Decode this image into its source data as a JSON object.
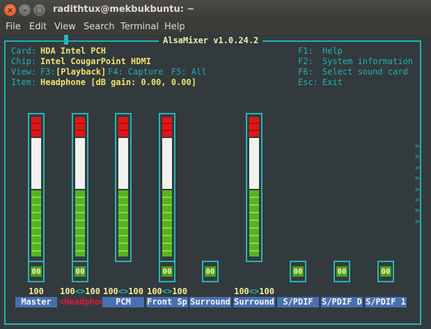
{
  "window": {
    "title": "radithtux@mekbukbuntu: ~",
    "close_glyph": "×",
    "min_glyph": "–",
    "max_glyph": "□"
  },
  "menu": [
    "File",
    "Edit",
    "View",
    "Search",
    "Terminal",
    "Help"
  ],
  "alsamixer": {
    "title": "AlsaMixer v1.0.24.2",
    "card": {
      "label": "Card:",
      "value": "HDA Intel PCH"
    },
    "chip": {
      "label": "Chip:",
      "value": "Intel CougarPoint HDMI"
    },
    "view": {
      "label": "View:",
      "f3": "F3:",
      "playback": "[Playback]",
      "f4": "F4: Capture",
      "f5": "F5: All"
    },
    "item": {
      "label": "Item:",
      "value": "Headphone [dB gain: 0.00, 0.00]"
    },
    "keys": [
      {
        "key": "F1:",
        "action": "Help"
      },
      {
        "key": "F2:",
        "action": "System information"
      },
      {
        "key": "F6:",
        "action": "Select sound card"
      },
      {
        "key": "Esc:",
        "action": "Exit"
      }
    ],
    "channels": [
      {
        "label": "Master",
        "volume": "100",
        "mute": "00",
        "has_bar": true,
        "level": 1.0,
        "selected": false
      },
      {
        "label": "<Headphon>",
        "volume": "100<>100",
        "mute": "00",
        "has_bar": true,
        "level": 1.0,
        "selected": true
      },
      {
        "label": "PCM",
        "volume": "100<>100",
        "mute": "",
        "has_bar": true,
        "level": 1.0,
        "selected": false
      },
      {
        "label": "Front Sp",
        "volume": "100<>100",
        "mute": "00",
        "has_bar": true,
        "level": 1.0,
        "selected": false
      },
      {
        "label": "Surround",
        "volume": "",
        "mute": "00",
        "has_bar": false,
        "level": 0,
        "selected": false
      },
      {
        "label": "Surround",
        "volume": "100<>100",
        "mute": "",
        "has_bar": true,
        "level": 1.0,
        "selected": false
      },
      {
        "label": "S/PDIF",
        "volume": "",
        "mute": "00",
        "has_bar": false,
        "level": 0,
        "selected": false
      },
      {
        "label": "S/PDIF D",
        "volume": "",
        "mute": "00",
        "has_bar": false,
        "level": 0,
        "selected": false
      },
      {
        "label": "S/PDIF 1",
        "volume": "",
        "mute": "00",
        "has_bar": false,
        "level": 0,
        "selected": false
      }
    ],
    "more_indicator": ">"
  }
}
